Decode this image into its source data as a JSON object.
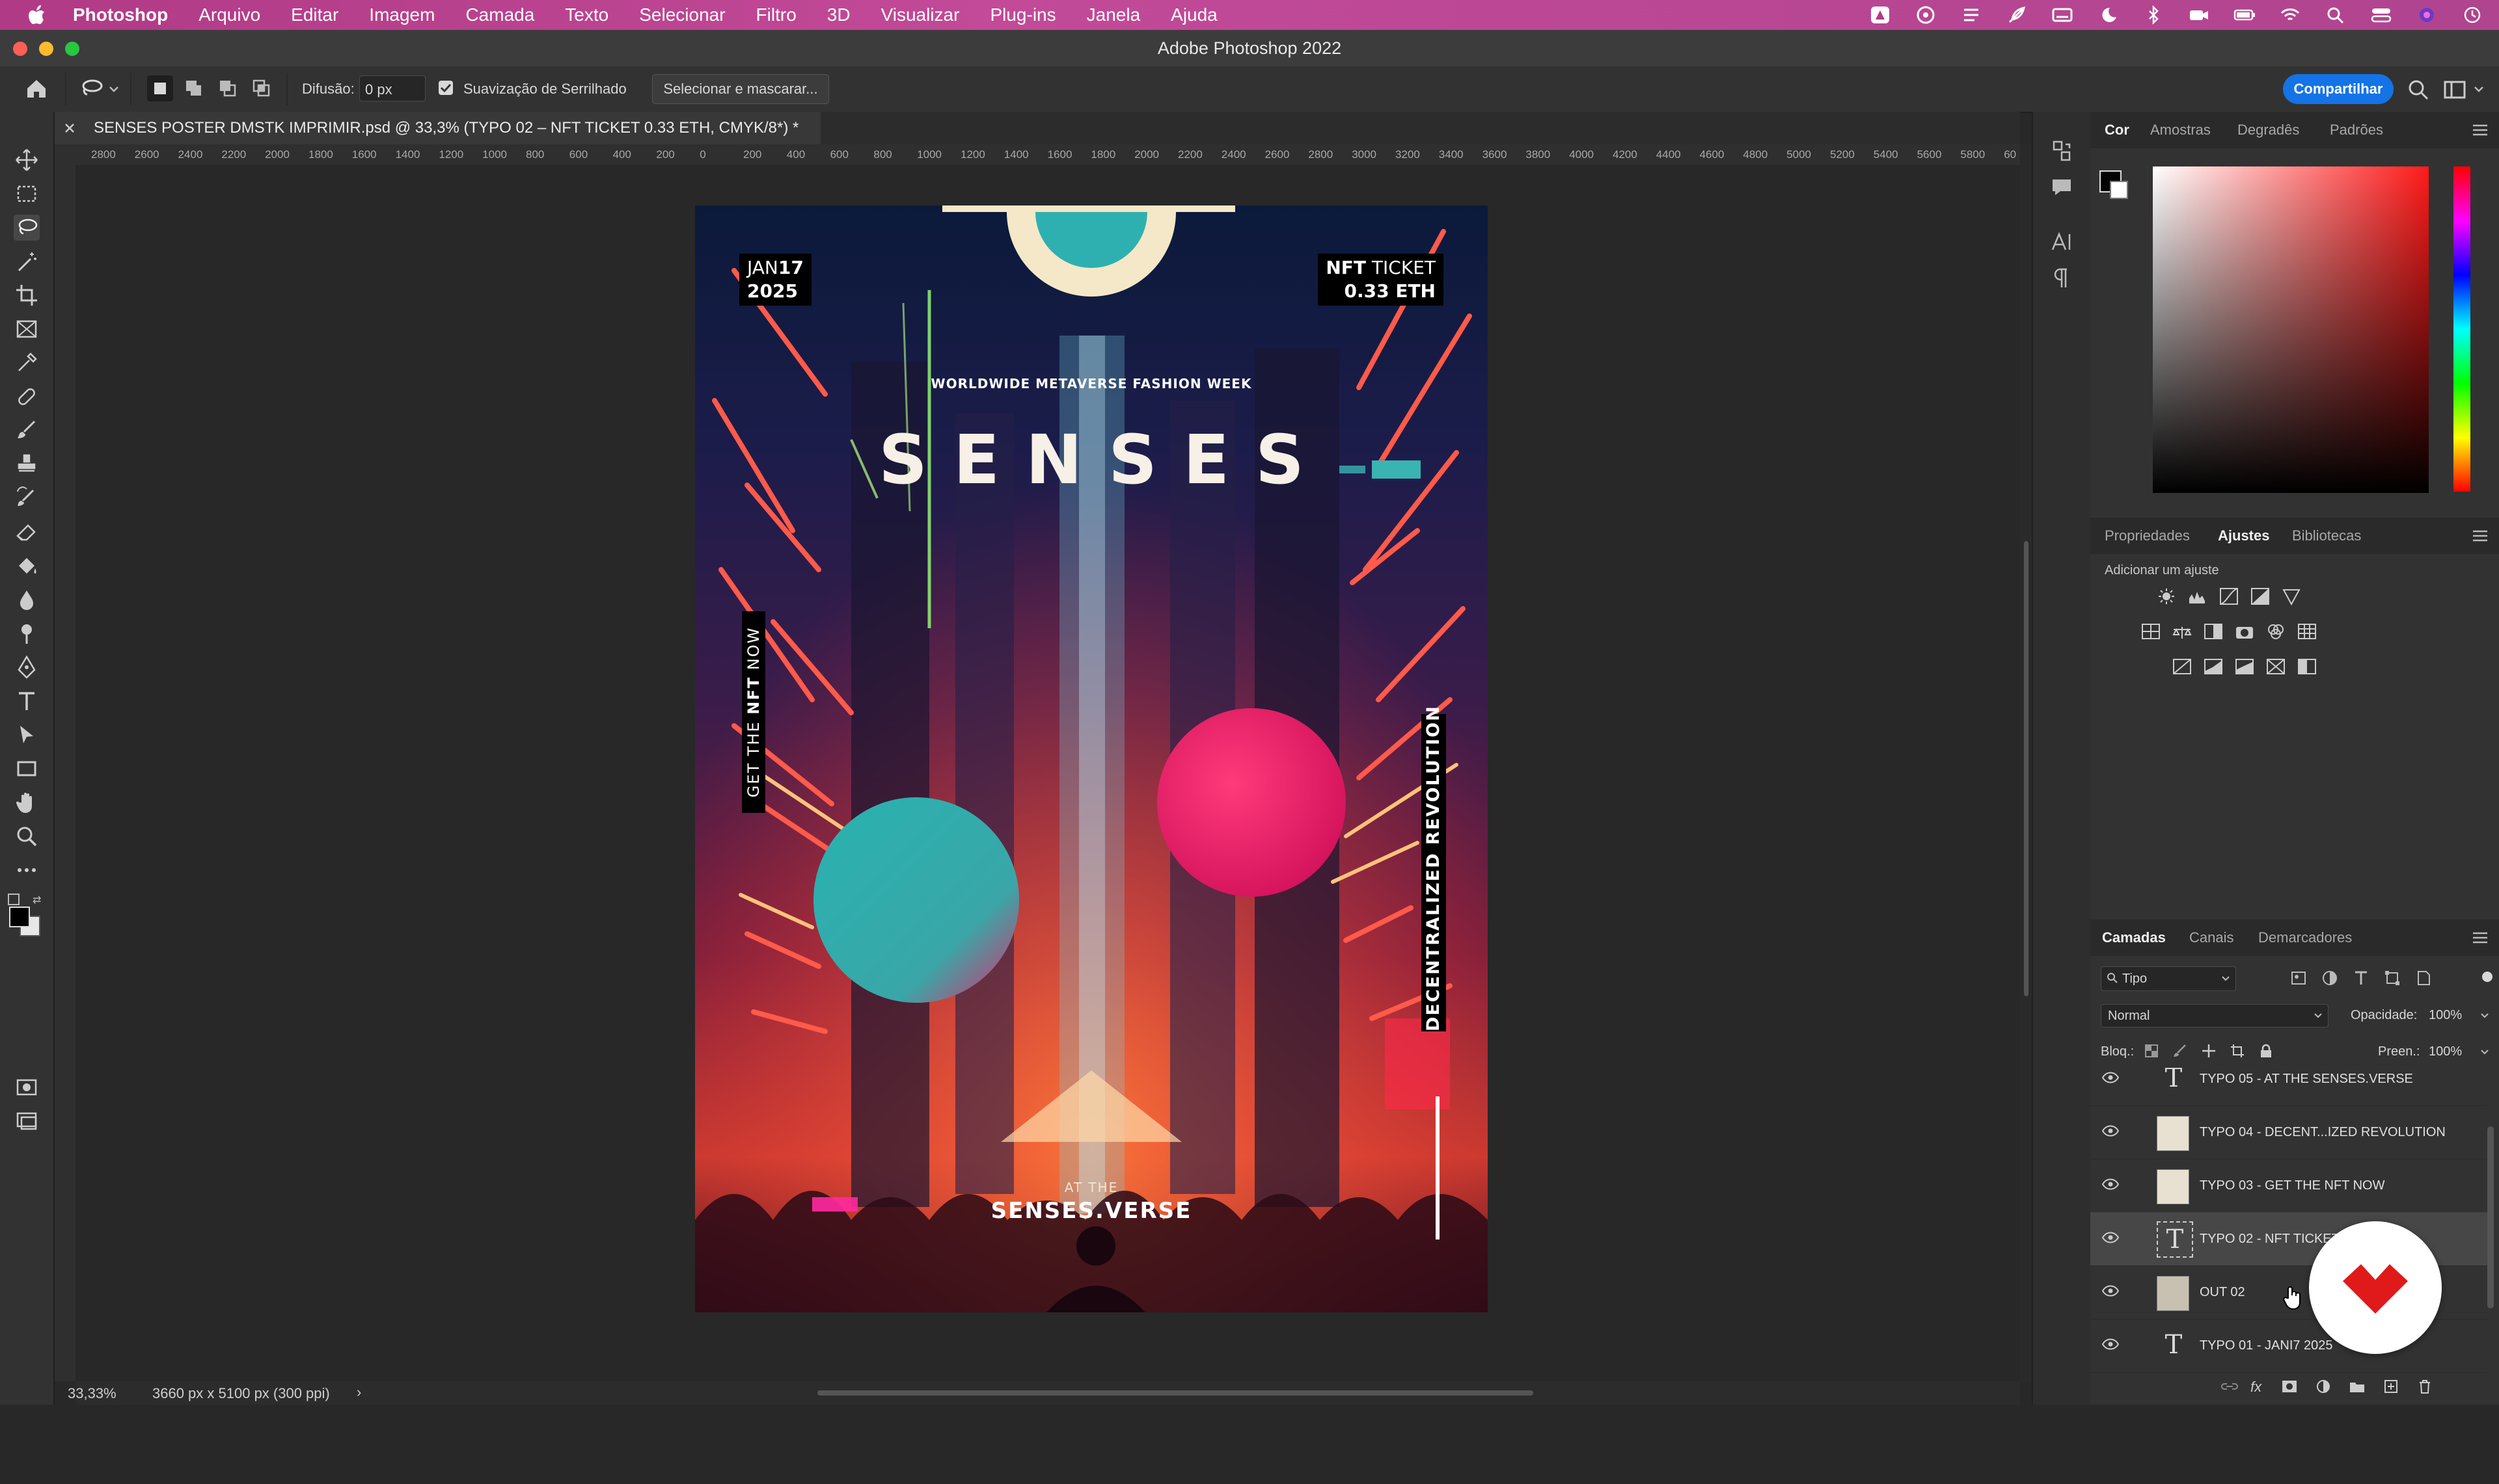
{
  "menubar": {
    "items": [
      "Photoshop",
      "Arquivo",
      "Editar",
      "Imagem",
      "Camada",
      "Texto",
      "Selecionar",
      "Filtro",
      "3D",
      "Visualizar",
      "Plug-ins",
      "Janela",
      "Ajuda"
    ]
  },
  "window": {
    "title": "Adobe Photoshop 2022"
  },
  "options_bar": {
    "feather_label": "Difusão:",
    "feather_value": "0 px",
    "antialias_label": "Suavização de Serrilhado",
    "antialias_checked": true,
    "select_mask_label": "Selecionar e mascarar...",
    "share_label": "Compartilhar"
  },
  "document": {
    "tab_title": "SENSES POSTER DMSTK IMPRIMIR.psd @ 33,3% (TYPO 02 – NFT TICKET 0.33 ETH, CMYK/8*) *",
    "zoom": "33,33%",
    "dimensions": "3660 px x 5100 px (300 ppi)"
  },
  "ruler": {
    "labels": [
      "2800",
      "2600",
      "2400",
      "2200",
      "2000",
      "1800",
      "1600",
      "1400",
      "1200",
      "1000",
      "800",
      "600",
      "400",
      "200",
      "0",
      "200",
      "400",
      "600",
      "800",
      "1000",
      "1200",
      "1400",
      "1600",
      "1800",
      "2000",
      "2200",
      "2400",
      "2600",
      "2800",
      "3000",
      "3200",
      "3400",
      "3600",
      "3800",
      "4000",
      "4200",
      "4400",
      "4600",
      "4800",
      "5000",
      "5200",
      "5400",
      "5600",
      "5800",
      "60"
    ]
  },
  "poster": {
    "date_month": "JAN",
    "date_day": "17",
    "date_year": "2025",
    "ticket_word1": "NFT",
    "ticket_word2": "TICKET",
    "ticket_price": "0.33 ETH",
    "event": "WORLDWIDE METAVERSE FASHION WEEK",
    "headline": "SENSES",
    "side_left_a": "GET THE ",
    "side_left_b": "NFT",
    "side_left_c": " NOW",
    "side_right": "DECENTRALIZED REVOLUTION",
    "at_the": "AT THE",
    "venue": "SENSES.VERSE"
  },
  "color_panel": {
    "tabs": [
      "Cor",
      "Amostras",
      "Degradês",
      "Padrões"
    ],
    "active": "Cor"
  },
  "adjust_panel": {
    "tabs": [
      "Propriedades",
      "Ajustes",
      "Bibliotecas"
    ],
    "active": "Ajustes",
    "hint": "Adicionar um ajuste"
  },
  "layers_panel": {
    "tabs": [
      "Camadas",
      "Canais",
      "Demarcadores"
    ],
    "active": "Camadas",
    "filter_label": "Tipo",
    "blend_mode": "Normal",
    "opacity_label": "Opacidade:",
    "opacity_value": "100%",
    "lock_label": "Bloq.:",
    "fill_label": "Preen.:",
    "fill_value": "100%",
    "layers": [
      {
        "name": "TYPO 05 - AT THE SENSES.VERSE",
        "kind": "text"
      },
      {
        "name": "TYPO 04 - DECENT...IZED REVOLUTION",
        "kind": "image"
      },
      {
        "name": "TYPO 03 - GET THE NFT NOW",
        "kind": "image"
      },
      {
        "name": "TYPO 02 - NFT TICKET 0.33 ETH",
        "kind": "text",
        "selected": true
      },
      {
        "name": "OUT 02",
        "kind": "image"
      },
      {
        "name": "TYPO 01 - JANI7 2025",
        "kind": "text"
      }
    ]
  },
  "colors": {
    "menubar": "#b03a86",
    "accent_blue": "#1473e6",
    "app_bg": "#323232"
  }
}
